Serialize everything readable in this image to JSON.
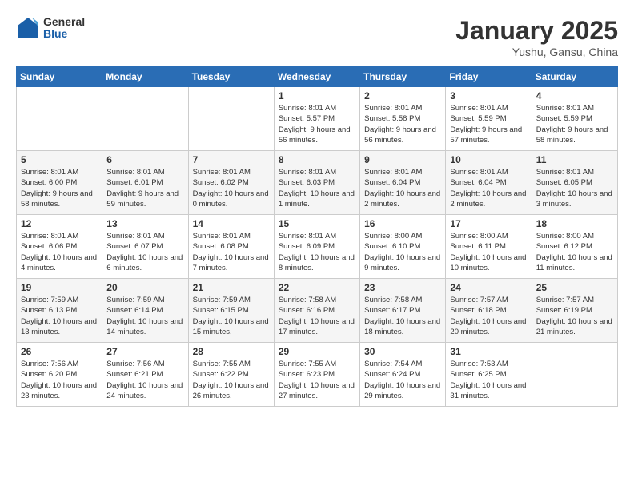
{
  "header": {
    "logo_general": "General",
    "logo_blue": "Blue",
    "month_title": "January 2025",
    "location": "Yushu, Gansu, China"
  },
  "weekdays": [
    "Sunday",
    "Monday",
    "Tuesday",
    "Wednesday",
    "Thursday",
    "Friday",
    "Saturday"
  ],
  "weeks": [
    [
      {
        "day": "",
        "info": ""
      },
      {
        "day": "",
        "info": ""
      },
      {
        "day": "",
        "info": ""
      },
      {
        "day": "1",
        "info": "Sunrise: 8:01 AM\nSunset: 5:57 PM\nDaylight: 9 hours and 56 minutes."
      },
      {
        "day": "2",
        "info": "Sunrise: 8:01 AM\nSunset: 5:58 PM\nDaylight: 9 hours and 56 minutes."
      },
      {
        "day": "3",
        "info": "Sunrise: 8:01 AM\nSunset: 5:59 PM\nDaylight: 9 hours and 57 minutes."
      },
      {
        "day": "4",
        "info": "Sunrise: 8:01 AM\nSunset: 5:59 PM\nDaylight: 9 hours and 58 minutes."
      }
    ],
    [
      {
        "day": "5",
        "info": "Sunrise: 8:01 AM\nSunset: 6:00 PM\nDaylight: 9 hours and 58 minutes."
      },
      {
        "day": "6",
        "info": "Sunrise: 8:01 AM\nSunset: 6:01 PM\nDaylight: 9 hours and 59 minutes."
      },
      {
        "day": "7",
        "info": "Sunrise: 8:01 AM\nSunset: 6:02 PM\nDaylight: 10 hours and 0 minutes."
      },
      {
        "day": "8",
        "info": "Sunrise: 8:01 AM\nSunset: 6:03 PM\nDaylight: 10 hours and 1 minute."
      },
      {
        "day": "9",
        "info": "Sunrise: 8:01 AM\nSunset: 6:04 PM\nDaylight: 10 hours and 2 minutes."
      },
      {
        "day": "10",
        "info": "Sunrise: 8:01 AM\nSunset: 6:04 PM\nDaylight: 10 hours and 2 minutes."
      },
      {
        "day": "11",
        "info": "Sunrise: 8:01 AM\nSunset: 6:05 PM\nDaylight: 10 hours and 3 minutes."
      }
    ],
    [
      {
        "day": "12",
        "info": "Sunrise: 8:01 AM\nSunset: 6:06 PM\nDaylight: 10 hours and 4 minutes."
      },
      {
        "day": "13",
        "info": "Sunrise: 8:01 AM\nSunset: 6:07 PM\nDaylight: 10 hours and 6 minutes."
      },
      {
        "day": "14",
        "info": "Sunrise: 8:01 AM\nSunset: 6:08 PM\nDaylight: 10 hours and 7 minutes."
      },
      {
        "day": "15",
        "info": "Sunrise: 8:01 AM\nSunset: 6:09 PM\nDaylight: 10 hours and 8 minutes."
      },
      {
        "day": "16",
        "info": "Sunrise: 8:00 AM\nSunset: 6:10 PM\nDaylight: 10 hours and 9 minutes."
      },
      {
        "day": "17",
        "info": "Sunrise: 8:00 AM\nSunset: 6:11 PM\nDaylight: 10 hours and 10 minutes."
      },
      {
        "day": "18",
        "info": "Sunrise: 8:00 AM\nSunset: 6:12 PM\nDaylight: 10 hours and 11 minutes."
      }
    ],
    [
      {
        "day": "19",
        "info": "Sunrise: 7:59 AM\nSunset: 6:13 PM\nDaylight: 10 hours and 13 minutes."
      },
      {
        "day": "20",
        "info": "Sunrise: 7:59 AM\nSunset: 6:14 PM\nDaylight: 10 hours and 14 minutes."
      },
      {
        "day": "21",
        "info": "Sunrise: 7:59 AM\nSunset: 6:15 PM\nDaylight: 10 hours and 15 minutes."
      },
      {
        "day": "22",
        "info": "Sunrise: 7:58 AM\nSunset: 6:16 PM\nDaylight: 10 hours and 17 minutes."
      },
      {
        "day": "23",
        "info": "Sunrise: 7:58 AM\nSunset: 6:17 PM\nDaylight: 10 hours and 18 minutes."
      },
      {
        "day": "24",
        "info": "Sunrise: 7:57 AM\nSunset: 6:18 PM\nDaylight: 10 hours and 20 minutes."
      },
      {
        "day": "25",
        "info": "Sunrise: 7:57 AM\nSunset: 6:19 PM\nDaylight: 10 hours and 21 minutes."
      }
    ],
    [
      {
        "day": "26",
        "info": "Sunrise: 7:56 AM\nSunset: 6:20 PM\nDaylight: 10 hours and 23 minutes."
      },
      {
        "day": "27",
        "info": "Sunrise: 7:56 AM\nSunset: 6:21 PM\nDaylight: 10 hours and 24 minutes."
      },
      {
        "day": "28",
        "info": "Sunrise: 7:55 AM\nSunset: 6:22 PM\nDaylight: 10 hours and 26 minutes."
      },
      {
        "day": "29",
        "info": "Sunrise: 7:55 AM\nSunset: 6:23 PM\nDaylight: 10 hours and 27 minutes."
      },
      {
        "day": "30",
        "info": "Sunrise: 7:54 AM\nSunset: 6:24 PM\nDaylight: 10 hours and 29 minutes."
      },
      {
        "day": "31",
        "info": "Sunrise: 7:53 AM\nSunset: 6:25 PM\nDaylight: 10 hours and 31 minutes."
      },
      {
        "day": "",
        "info": ""
      }
    ]
  ]
}
